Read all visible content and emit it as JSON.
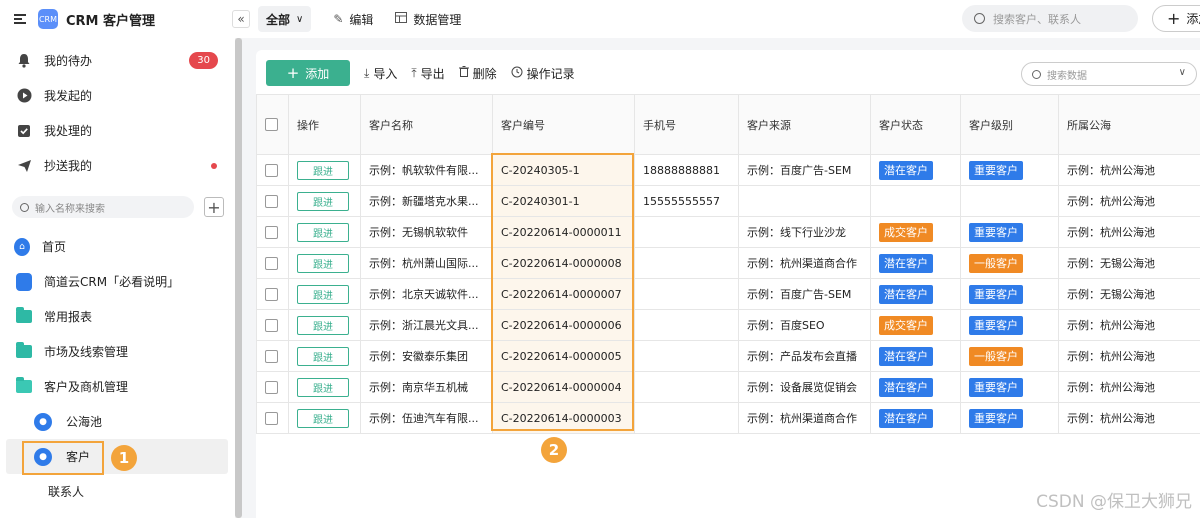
{
  "app": {
    "title": "CRM 客户管理",
    "logo_text": "CRM"
  },
  "sidebar": {
    "todo": {
      "label": "我的待办",
      "badge": "30"
    },
    "initiated": {
      "label": "我发起的"
    },
    "handled": {
      "label": "我处理的"
    },
    "cc": {
      "label": "抄送我的"
    },
    "search_placeholder": "输入名称来搜索",
    "items": [
      {
        "label": "首页"
      },
      {
        "label": "简道云CRM「必看说明」"
      },
      {
        "label": "常用报表"
      },
      {
        "label": "市场及线索管理"
      },
      {
        "label": "客户及商机管理"
      }
    ],
    "sub_items": [
      {
        "label": "公海池"
      },
      {
        "label": "客户"
      },
      {
        "label": "联系人"
      }
    ]
  },
  "topbar": {
    "view_label": "全部",
    "edit_label": "编辑",
    "data_manage_label": "数据管理",
    "search_placeholder": "搜索客户、联系人",
    "new_label": "添加"
  },
  "toolbar": {
    "add_label": "添加",
    "import_label": "导入",
    "export_label": "导出",
    "delete_label": "删除",
    "log_label": "操作记录",
    "search_placeholder": "搜索数据"
  },
  "table": {
    "headers": [
      "操作",
      "客户名称",
      "客户编号",
      "手机号",
      "客户来源",
      "客户状态",
      "客户级别",
      "所属公海"
    ],
    "follow_label": "跟进",
    "rows": [
      {
        "name": "示例：帆软软件有限...",
        "code": "C-20240305-1",
        "phone": "18888888881",
        "source": "示例：百度广告-SEM",
        "status": "潜在客户",
        "status_color": "#2f7be9",
        "level": "重要客户",
        "level_color": "#2f7be9",
        "pool": "示例：杭州公海池"
      },
      {
        "name": "示例：新疆塔克水果...",
        "code": "C-20240301-1",
        "phone": "15555555557",
        "source": "",
        "status": "",
        "status_color": "",
        "level": "",
        "level_color": "",
        "pool": "示例：杭州公海池"
      },
      {
        "name": "示例：无锡帆软软件",
        "code": "C-20220614-0000011",
        "phone": "",
        "source": "示例：线下行业沙龙",
        "status": "成交客户",
        "status_color": "#f08a24",
        "level": "重要客户",
        "level_color": "#2f7be9",
        "pool": "示例：杭州公海池"
      },
      {
        "name": "示例：杭州萧山国际...",
        "code": "C-20220614-0000008",
        "phone": "",
        "source": "示例：杭州渠道商合作",
        "status": "潜在客户",
        "status_color": "#2f7be9",
        "level": "一般客户",
        "level_color": "#f08a24",
        "pool": "示例：无锡公海池"
      },
      {
        "name": "示例：北京天诚软件...",
        "code": "C-20220614-0000007",
        "phone": "",
        "source": "示例：百度广告-SEM",
        "status": "潜在客户",
        "status_color": "#2f7be9",
        "level": "重要客户",
        "level_color": "#2f7be9",
        "pool": "示例：无锡公海池"
      },
      {
        "name": "示例：浙江晨光文具...",
        "code": "C-20220614-0000006",
        "phone": "",
        "source": "示例：百度SEO",
        "status": "成交客户",
        "status_color": "#f08a24",
        "level": "重要客户",
        "level_color": "#2f7be9",
        "pool": "示例：杭州公海池"
      },
      {
        "name": "示例：安徽泰乐集团",
        "code": "C-20220614-0000005",
        "phone": "",
        "source": "示例：产品发布会直播",
        "status": "潜在客户",
        "status_color": "#2f7be9",
        "level": "一般客户",
        "level_color": "#f08a24",
        "pool": "示例：杭州公海池"
      },
      {
        "name": "示例：南京华五机械",
        "code": "C-20220614-0000004",
        "phone": "",
        "source": "示例：设备展览促销会",
        "status": "潜在客户",
        "status_color": "#2f7be9",
        "level": "重要客户",
        "level_color": "#2f7be9",
        "pool": "示例：杭州公海池"
      },
      {
        "name": "示例：伍迪汽车有限...",
        "code": "C-20220614-0000003",
        "phone": "",
        "source": "示例：杭州渠道商合作",
        "status": "潜在客户",
        "status_color": "#2f7be9",
        "level": "重要客户",
        "level_color": "#2f7be9",
        "pool": "示例：杭州公海池"
      }
    ]
  },
  "annotations": {
    "marker_1": "1",
    "marker_2": "2"
  },
  "watermark": "CSDN @保卫大狮兄",
  "colors": {
    "accent": "#3bb08f",
    "highlight": "#f3a43b",
    "blue": "#2f7be9",
    "orange": "#f08a24"
  }
}
